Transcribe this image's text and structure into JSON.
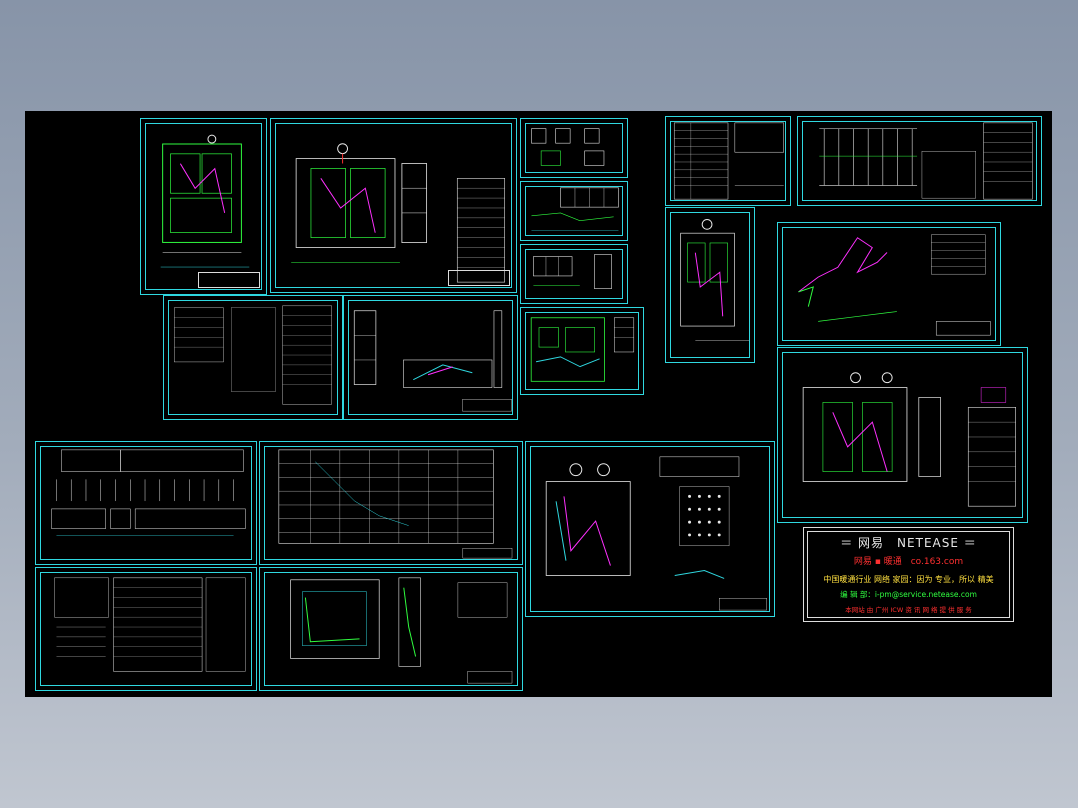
{
  "viewport": {
    "background": "#000000",
    "sheet_frame_color": "#2fd8e0"
  },
  "netease": {
    "title": "＝ 网易　NETEASE ＝",
    "subtitle": "网易 ▪ 暖通　co.163.com",
    "line1": "中国暖通行业 网络 家园：因为 专业，所以 精美",
    "line2": "编 辑 部：i-pm@service.netease.com",
    "line3": "本网站 由 广州 ICW 资 讯 网 络 提 供 服 务"
  },
  "colors": {
    "cyan": "#2fd8e0",
    "green": "#30ff40",
    "magenta": "#ff30ff",
    "white": "#e8e8e8",
    "yellow": "#ffe040",
    "red": "#ff3030"
  }
}
